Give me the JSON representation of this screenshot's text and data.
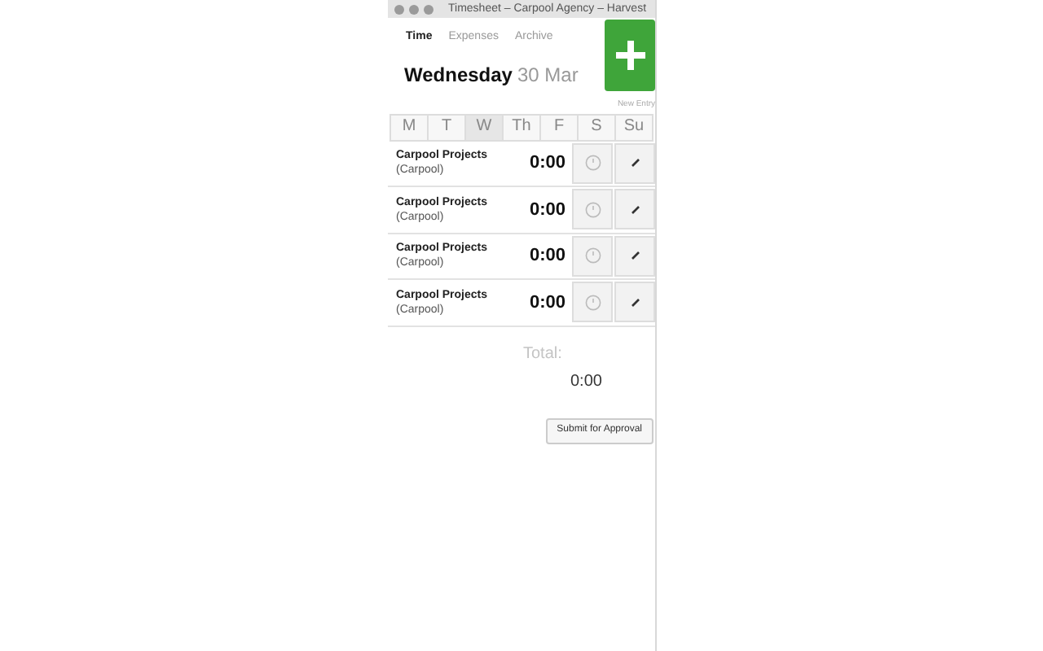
{
  "window": {
    "title": "Timesheet – Carpool Agency – Harvest"
  },
  "tabs": [
    {
      "label": "Time",
      "selected": true
    },
    {
      "label": "Expenses",
      "selected": false
    },
    {
      "label": "Archive",
      "selected": false
    }
  ],
  "new_entry": {
    "label": "New Entry"
  },
  "date": {
    "weekday": "Wednesday",
    "day": "30 Mar"
  },
  "days": [
    {
      "label": "M",
      "selected": false
    },
    {
      "label": "T",
      "selected": false
    },
    {
      "label": "W",
      "selected": true
    },
    {
      "label": "Th",
      "selected": false
    },
    {
      "label": "F",
      "selected": false
    },
    {
      "label": "S",
      "selected": false
    },
    {
      "label": "Su",
      "selected": false
    }
  ],
  "entries": [
    {
      "project": "Carpool Projects",
      "client": "(Carpool)",
      "time": "0:00"
    },
    {
      "project": "Carpool Projects",
      "client": "(Carpool)",
      "time": "0:00"
    },
    {
      "project": "Carpool Projects",
      "client": "(Carpool)",
      "time": "0:00"
    },
    {
      "project": "Carpool Projects",
      "client": "(Carpool)",
      "time": "0:00"
    }
  ],
  "total": {
    "label": "Total:",
    "value": "0:00"
  },
  "submit_button": "Submit for Approval"
}
